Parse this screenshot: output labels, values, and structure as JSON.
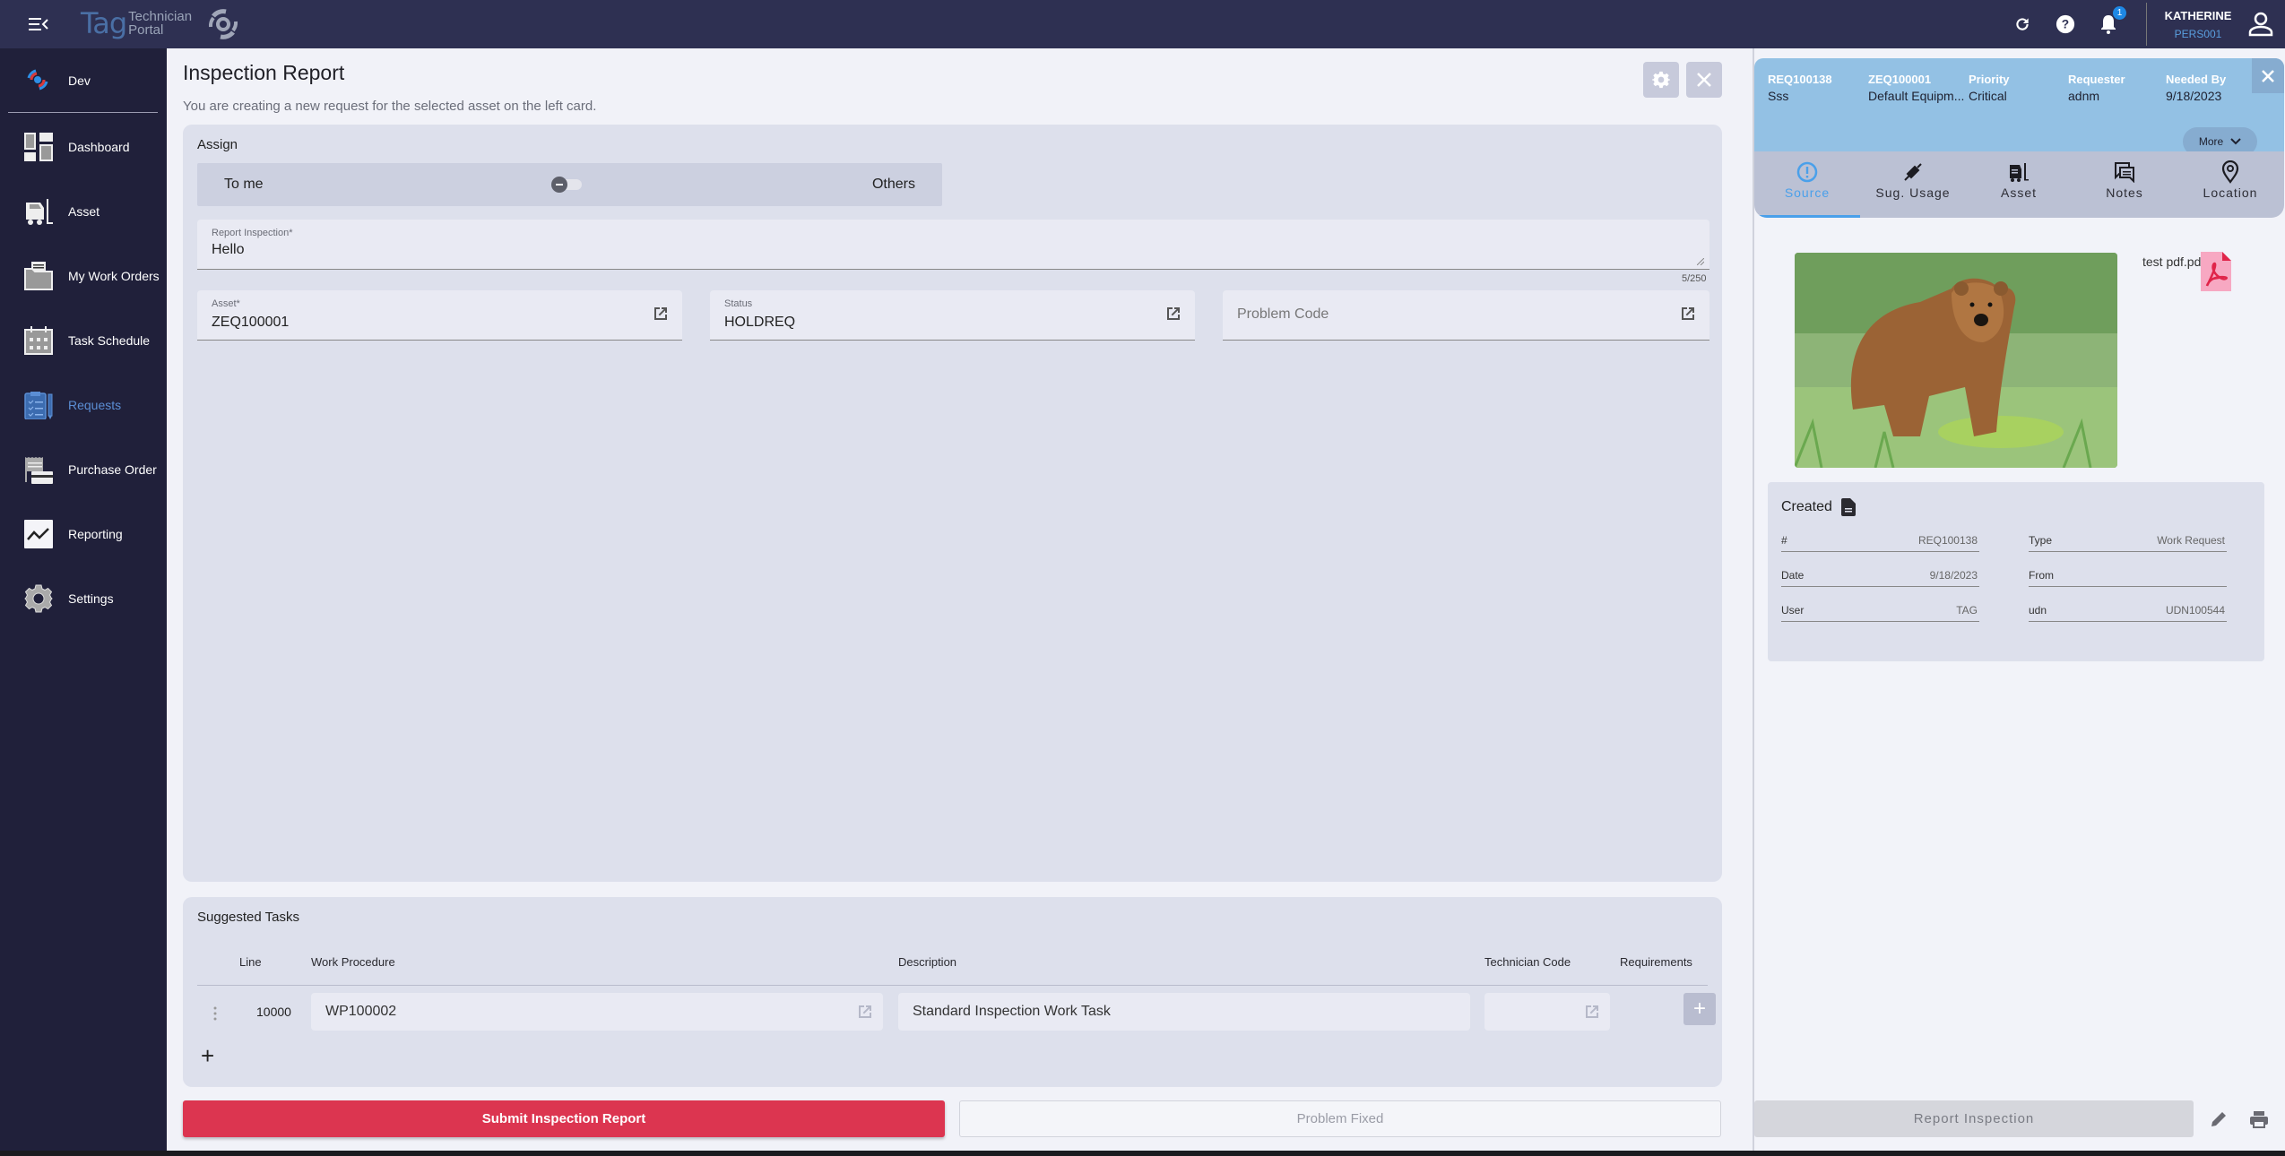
{
  "topbar": {
    "logo_main": "Tag",
    "logo_sub1": "Technician",
    "logo_sub2": "Portal",
    "notification_count": "1",
    "user_name": "KATHERINE",
    "user_id": "PERS001"
  },
  "sidebar": {
    "environment": "Dev",
    "items": [
      {
        "label": "Dashboard",
        "icon": "dashboard-icon"
      },
      {
        "label": "Asset",
        "icon": "forklift-icon"
      },
      {
        "label": "My Work Orders",
        "icon": "folder-icon"
      },
      {
        "label": "Task Schedule",
        "icon": "calendar-icon"
      },
      {
        "label": "Requests",
        "icon": "clipboard-icon",
        "active": true
      },
      {
        "label": "Purchase Order",
        "icon": "receipt-icon"
      },
      {
        "label": "Reporting",
        "icon": "chart-line-icon"
      },
      {
        "label": "Settings",
        "icon": "gear-icon"
      }
    ]
  },
  "main": {
    "title": "Inspection Report",
    "subtitle": "You are creating a new request for the selected asset on the left card.",
    "assign": {
      "label": "Assign",
      "left_option": "To me",
      "right_option": "Others"
    },
    "report_field": {
      "label": "Report Inspection*",
      "value": "Hello",
      "counter": "5/250"
    },
    "asset_field": {
      "label": "Asset*",
      "value": "ZEQ100001"
    },
    "status_field": {
      "label": "Status",
      "value": "HOLDREQ"
    },
    "problem_field": {
      "placeholder": "Problem Code"
    },
    "suggested_tasks": {
      "label": "Suggested Tasks",
      "columns": [
        "Line",
        "Work Procedure",
        "Description",
        "Technician Code",
        "Requirements"
      ],
      "rows": [
        {
          "line": "10000",
          "work_procedure": "WP100002",
          "description": "Standard Inspection Work Task",
          "technician_code": ""
        }
      ]
    },
    "submit_label": "Submit Inspection Report",
    "problem_fixed_label": "Problem Fixed"
  },
  "right_panel": {
    "header": {
      "request_id": "REQ100138",
      "request_desc": "Sss",
      "asset_id": "ZEQ100001",
      "asset_desc": "Default Equipm...",
      "priority_label": "Priority",
      "priority_value": "Critical",
      "requester_label": "Requester",
      "requester_value": "adnm",
      "needed_label": "Needed By",
      "needed_value": "9/18/2023",
      "more_label": "More"
    },
    "tabs": [
      {
        "label": "Source",
        "active": true
      },
      {
        "label": "Sug. Usage"
      },
      {
        "label": "Asset"
      },
      {
        "label": "Notes"
      },
      {
        "label": "Location"
      }
    ],
    "attachment_name": "test pdf.pdf",
    "created": {
      "title": "Created",
      "fields": [
        {
          "key": "#",
          "value": "REQ100138"
        },
        {
          "key": "Type",
          "value": "Work Request"
        },
        {
          "key": "Date",
          "value": "9/18/2023"
        },
        {
          "key": "From",
          "value": ""
        },
        {
          "key": "User",
          "value": "TAG"
        },
        {
          "key": "udn",
          "value": "UDN100544"
        }
      ]
    },
    "report_button": "Report Inspection"
  },
  "colors": {
    "topbar": "#2e3052",
    "sidebar": "#20203a",
    "accent_blue": "#4aa0ea",
    "submit_red": "#dc3550",
    "header_blue": "#93c1e4"
  }
}
